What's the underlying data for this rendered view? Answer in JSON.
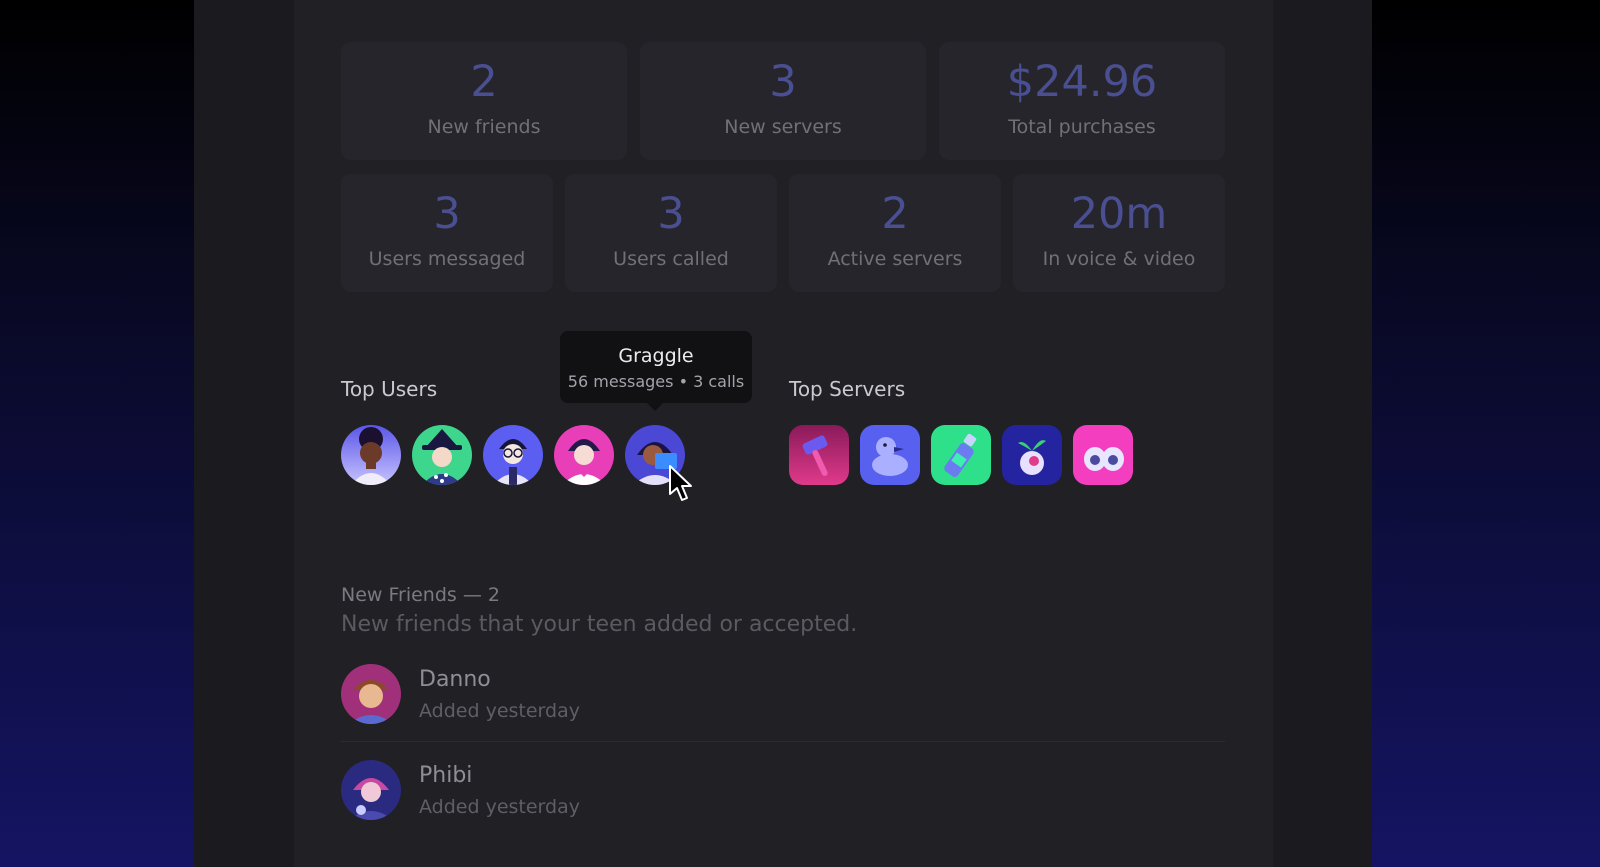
{
  "stats_row1": [
    {
      "value": "2",
      "label": "New friends"
    },
    {
      "value": "3",
      "label": "New servers"
    },
    {
      "value": "$24.96",
      "label": "Total purchases"
    }
  ],
  "stats_row2": [
    {
      "value": "3",
      "label": "Users messaged"
    },
    {
      "value": "3",
      "label": "Users called"
    },
    {
      "value": "2",
      "label": "Active servers"
    },
    {
      "value": "20m",
      "label": "In voice & video"
    }
  ],
  "top_users": {
    "title": "Top Users",
    "tooltip": {
      "name": "Graggle",
      "meta": "56 messages • 3 calls"
    }
  },
  "top_servers": {
    "title": "Top Servers"
  },
  "new_friends": {
    "title": "New Friends — 2",
    "subtitle": "New friends that your teen added or accepted.",
    "items": [
      {
        "name": "Danno",
        "added": "Added yesterday"
      },
      {
        "name": "Phibi",
        "added": "Added yesterday"
      }
    ]
  },
  "colors": {
    "stat_value": "#4a4f92",
    "panel": "#202025",
    "card": "#25252b",
    "tooltip": "#111114"
  }
}
